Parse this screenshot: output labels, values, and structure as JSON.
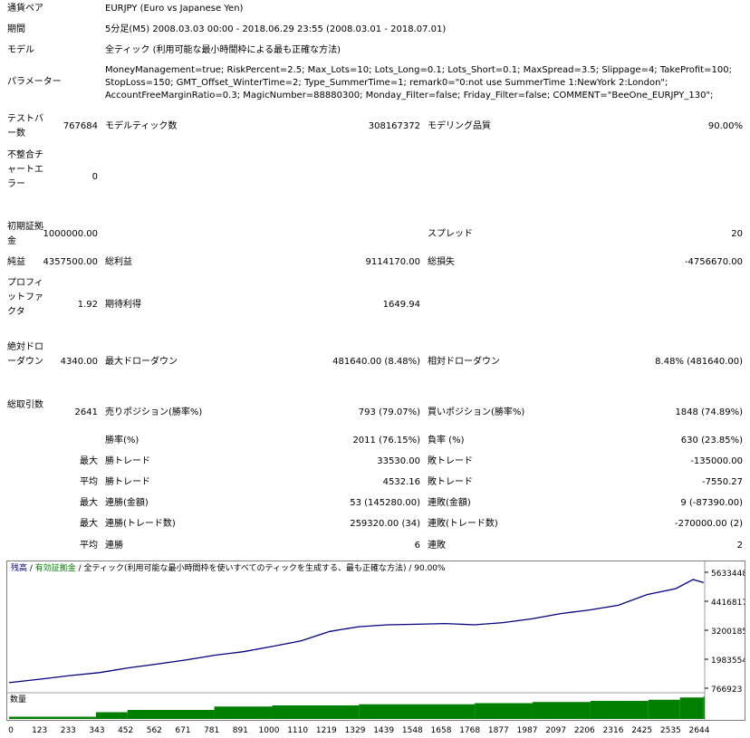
{
  "report": {
    "pair_label": "通貨ペア",
    "pair_value": "EURJPY (Euro vs Japanese Yen)",
    "period_label": "期間",
    "period_value": "5分足(M5) 2008.03.03 00:00 - 2018.06.29 23:55 (2008.03.01 - 2018.07.01)",
    "model_label": "モデル",
    "model_value": "全ティック (利用可能な最小時間枠による最も正確な方法)",
    "params_label": "パラメーター",
    "params_lines": [
      "MoneyManagement=true; RiskPercent=2.5; Max_Lots=10; Lots_Long=0.1; Lots_Short=0.1; MaxSpread=3.5; Slippage=4; TakeProfit=100;",
      "StopLoss=150; GMT_Offset_WinterTime=2; Type_SummerTime=1; remark0=\"0:not use SummerTime 1:NewYork 2:London\";",
      "AccountFreeMarginRatio=0.3; MagicNumber=88880300; Monday_Filter=false; Friday_Filter=false; COMMENT=\"BeeOne_EURJPY_130\";"
    ],
    "bars_label": "テストバー数",
    "bars_value": "767684",
    "ticks_label": "モデルティック数",
    "ticks_value": "308167372",
    "quality_label": "モデリング品質",
    "quality_value": "90.00%",
    "mismatch_label": "不整合チャートエラー",
    "mismatch_value": "0",
    "deposit_label": "初期証拠金",
    "deposit_value": "1000000.00",
    "spread_label": "スプレッド",
    "spread_value": "20",
    "net_label": "純益",
    "net_value": "4357500.00",
    "gross_profit_label": "総利益",
    "gross_profit_value": "9114170.00",
    "gross_loss_label": "総損失",
    "gross_loss_value": "-4756670.00",
    "pf_label": "プロフィットファクタ",
    "pf_value": "1.92",
    "expected_label": "期待利得",
    "expected_value": "1649.94",
    "abs_dd_label": "絶対ドローダウン",
    "abs_dd_value": "4340.00",
    "max_dd_label": "最大ドローダウン",
    "max_dd_value": "481640.00 (8.48%)",
    "rel_dd_label": "相対ドローダウン",
    "rel_dd_value": "8.48% (481640.00)",
    "total_label": "総取引数",
    "total_value": "2641",
    "short_label": "売りポジション(勝率%)",
    "short_value": "793 (79.07%)",
    "long_label": "買いポジション(勝率%)",
    "long_value": "1848 (74.89%)",
    "win_rate_label": "勝率(%)",
    "win_rate_value": "2011 (76.15%)",
    "loss_rate_label": "負率 (%)",
    "loss_rate_value": "630 (23.85%)",
    "max_word": "最大",
    "avg_word": "平均",
    "largest_win_label": "勝トレード",
    "largest_win_value": "33530.00",
    "largest_loss_label": "敗トレード",
    "largest_loss_value": "-135000.00",
    "avg_win_label": "勝トレード",
    "avg_win_value": "4532.16",
    "avg_loss_label": "敗トレード",
    "avg_loss_value": "-7550.27",
    "max_consec_wins_money_label": "連勝(金額)",
    "max_consec_wins_money_value": "53 (145280.00)",
    "max_consec_losses_money_label": "連敗(金額)",
    "max_consec_losses_money_value": "9 (-87390.00)",
    "max_consec_wins_trades_label": "連勝(トレード数)",
    "max_consec_wins_trades_value": "259320.00 (34)",
    "max_consec_losses_trades_label": "連敗(トレード数)",
    "max_consec_losses_trades_value": "-270000.00 (2)",
    "avg_consec_wins_label": "連勝",
    "avg_consec_wins_value": "6",
    "avg_consec_losses_label": "連敗",
    "avg_consec_losses_value": "2"
  },
  "chart": {
    "legend_balance": "残高",
    "legend_sep1": " / ",
    "legend_equity": "有効証拠金",
    "legend_rest": " / 全ティック(利用可能な最小時間枠を使いすべてのティックを生成する、最も正確な方法) / 90.00%",
    "volume_label": "数量",
    "colors": {
      "balance": "#000080",
      "volume": "#008000",
      "legend_equity": "#008000"
    }
  },
  "chart_data": {
    "type": "line",
    "title": "",
    "series": [
      {
        "name": "残高",
        "x": [
          0,
          123,
          233,
          343,
          452,
          562,
          671,
          781,
          891,
          1000,
          1110,
          1219,
          1329,
          1439,
          1548,
          1658,
          1768,
          1877,
          1987,
          2097,
          2206,
          2316,
          2425,
          2535,
          2600,
          2640
        ],
        "values": [
          1000000,
          1150000,
          1300000,
          1420000,
          1620000,
          1780000,
          1950000,
          2150000,
          2300000,
          2520000,
          2750000,
          3150000,
          3350000,
          3430000,
          3450000,
          3480000,
          3430000,
          3520000,
          3680000,
          3900000,
          4050000,
          4250000,
          4700000,
          4950000,
          5330000,
          5200000
        ]
      }
    ],
    "volume": {
      "x": [
        0,
        330,
        450,
        780,
        1000,
        1330,
        1770,
        1990,
        2210,
        2430,
        2550,
        2640
      ],
      "values": [
        10,
        30,
        40,
        55,
        60,
        65,
        70,
        75,
        80,
        85,
        95,
        100
      ]
    },
    "y_ticks": [
      "5633448",
      "4416817",
      "3200185",
      "1983554",
      "766923"
    ],
    "x_ticks": [
      "0",
      "123",
      "233",
      "343",
      "452",
      "562",
      "671",
      "781",
      "891",
      "1000",
      "1110",
      "1219",
      "1329",
      "1439",
      "1548",
      "1658",
      "1768",
      "1877",
      "1987",
      "2097",
      "2206",
      "2316",
      "2425",
      "2535",
      "2644"
    ],
    "xlim": [
      0,
      2644
    ],
    "ylim": [
      766923,
      5633448
    ],
    "grid": false
  }
}
